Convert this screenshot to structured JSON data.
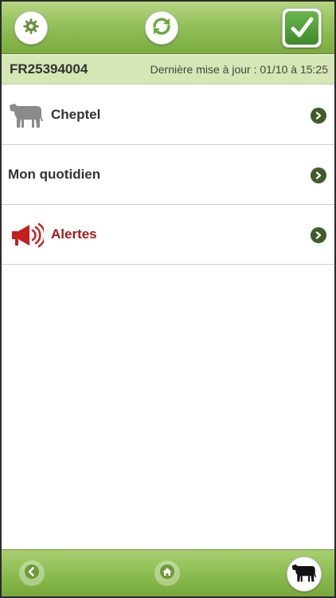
{
  "header": {
    "settings_icon": "gear-icon",
    "sync_icon": "refresh-icon",
    "validate_icon": "checkmark-icon",
    "accent_color": "#8dbd52"
  },
  "infobar": {
    "farm_id": "FR25394004",
    "last_update": "Dernière mise à jour : 01/10 à 15:25"
  },
  "menu": {
    "items": [
      {
        "label": "Cheptel",
        "icon": "cow-icon"
      },
      {
        "label": "Mon quotidien",
        "icon": ""
      },
      {
        "label": "Alertes",
        "icon": "megaphone-icon",
        "color": "#a51a1a"
      }
    ]
  },
  "footer": {
    "back_icon": "back-arrow-icon",
    "home_icon": "home-icon",
    "herd_icon": "cow-icon"
  }
}
